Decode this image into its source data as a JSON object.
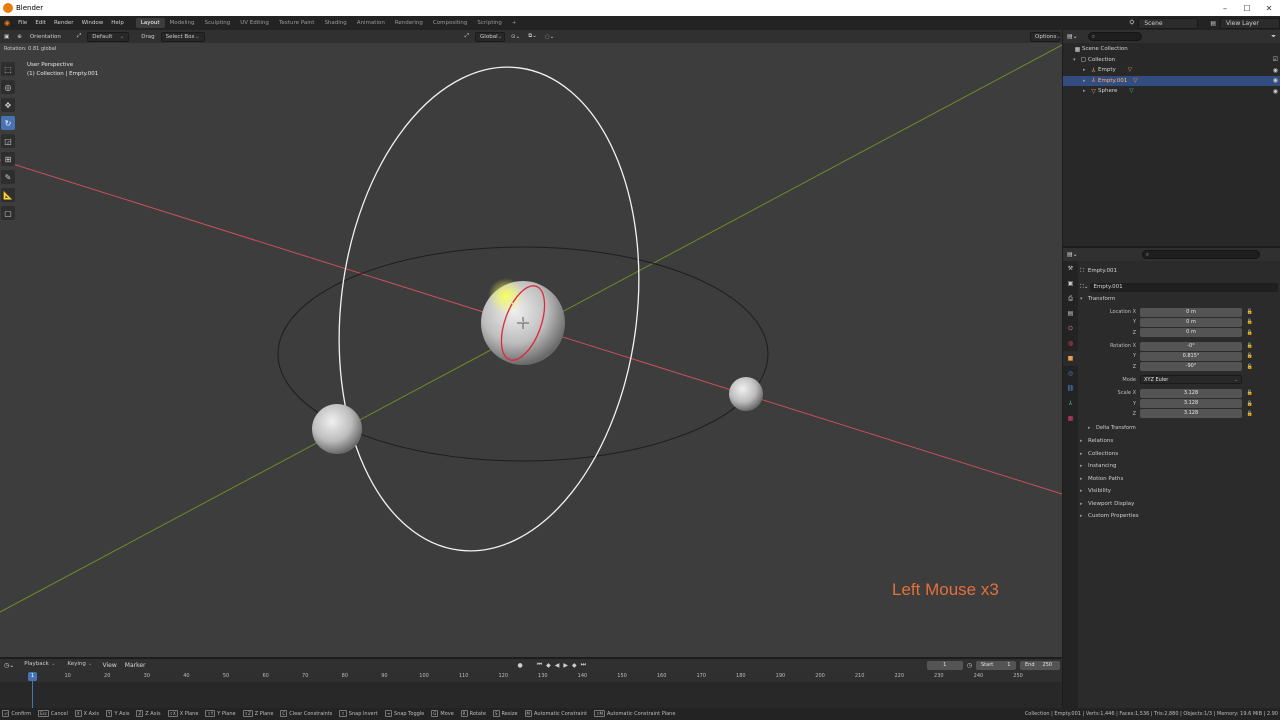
{
  "window": {
    "title": "Blender",
    "controls": [
      "–",
      "☐",
      "✕"
    ]
  },
  "menus": [
    "File",
    "Edit",
    "Render",
    "Window",
    "Help"
  ],
  "workspaces": [
    "Layout",
    "Modeling",
    "Sculpting",
    "UV Editing",
    "Texture Paint",
    "Shading",
    "Animation",
    "Rendering",
    "Compositing",
    "Scripting",
    "+"
  ],
  "active_workspace": "Layout",
  "scene": {
    "name": "Scene",
    "view_layer": "View Layer"
  },
  "viewport_header": {
    "orientation_label": "Orientation",
    "orientation_value": "Default",
    "drag_label": "Drag",
    "drag_value": "Select Box",
    "transform_orientation": "Global",
    "options_label": "Options"
  },
  "operator_status": "Rotation: 0.81 global",
  "viewport": {
    "view_name": "User Perspective",
    "context": "(1) Collection | Empty.001",
    "keystroke_overlay": "Left Mouse x3",
    "axis_x_color": "#c9505a",
    "axis_y_color": "#6d8a2a",
    "rotate_circle_red": "#e0283c",
    "gizmo_white": "#f2f2f2"
  },
  "tools": [
    "select-box",
    "cursor",
    "move",
    "rotate",
    "scale",
    "transform",
    "annotate",
    "measure",
    "add-cube"
  ],
  "active_tool": "rotate",
  "outliner": {
    "root": "Scene Collection",
    "collection": "Collection",
    "items": [
      {
        "name": "Empty",
        "selected": false,
        "type": "empty"
      },
      {
        "name": "Empty.001",
        "selected": true,
        "type": "empty"
      },
      {
        "name": "Sphere",
        "selected": false,
        "type": "mesh"
      }
    ]
  },
  "properties": {
    "object_name_top": "Empty.001",
    "object_name_field": "Empty.001",
    "transform_title": "Transform",
    "location": {
      "label": "Location X",
      "x": "0 m",
      "y": "0 m",
      "z": "0 m"
    },
    "rotation": {
      "label": "Rotation X",
      "x": "-0°",
      "y": "0.815°",
      "z": "-90°"
    },
    "mode_label": "Mode",
    "mode_value": "XYZ Euler",
    "scale": {
      "label": "Scale X",
      "x": "3.128",
      "y": "3.128",
      "z": "3.128"
    },
    "axis_y": "Y",
    "axis_z": "Z",
    "delta_transform": "Delta Transform",
    "panels": [
      "Relations",
      "Collections",
      "Instancing",
      "Motion Paths",
      "Visibility",
      "Viewport Display",
      "Custom Properties"
    ]
  },
  "timeline": {
    "menus": [
      "Playback",
      "Keying",
      "View",
      "Marker"
    ],
    "current_frame": "1",
    "start_label": "Start",
    "start_value": "1",
    "end_label": "End",
    "end_value": "250",
    "ticks": [
      "10",
      "20",
      "30",
      "40",
      "50",
      "60",
      "70",
      "80",
      "90",
      "100",
      "110",
      "120",
      "130",
      "140",
      "150",
      "160",
      "170",
      "180",
      "190",
      "200",
      "210",
      "220",
      "230",
      "240",
      "250"
    ],
    "playhead": "1"
  },
  "statusbar": {
    "keys": [
      {
        "k": "⏎",
        "label": "Confirm"
      },
      {
        "k": "Esc",
        "label": "Cancel"
      },
      {
        "k": "X",
        "label": "X Axis"
      },
      {
        "k": "Y",
        "label": "Y Axis"
      },
      {
        "k": "Z",
        "label": "Z Axis"
      },
      {
        "k": "⇧X",
        "label": "X Plane"
      },
      {
        "k": "⇧Y",
        "label": "Y Plane"
      },
      {
        "k": "⇧Z",
        "label": "Z Plane"
      },
      {
        "k": "C",
        "label": "Clear Constraints"
      },
      {
        "k": "⇧",
        "label": "Snap Invert"
      },
      {
        "k": "⇥",
        "label": "Snap Toggle"
      },
      {
        "k": "G",
        "label": "Move"
      },
      {
        "k": "R",
        "label": "Rotate"
      },
      {
        "k": "S",
        "label": "Resize"
      },
      {
        "k": "M",
        "label": "Automatic Constraint"
      },
      {
        "k": "⇧M",
        "label": "Automatic Constraint Plane"
      }
    ],
    "stats": "Collection | Empty.001 | Verts:1,446 | Faces:1,536 | Tris:2,880 | Objects:1/3 | Memory: 19.6 MiB | 2.90"
  }
}
